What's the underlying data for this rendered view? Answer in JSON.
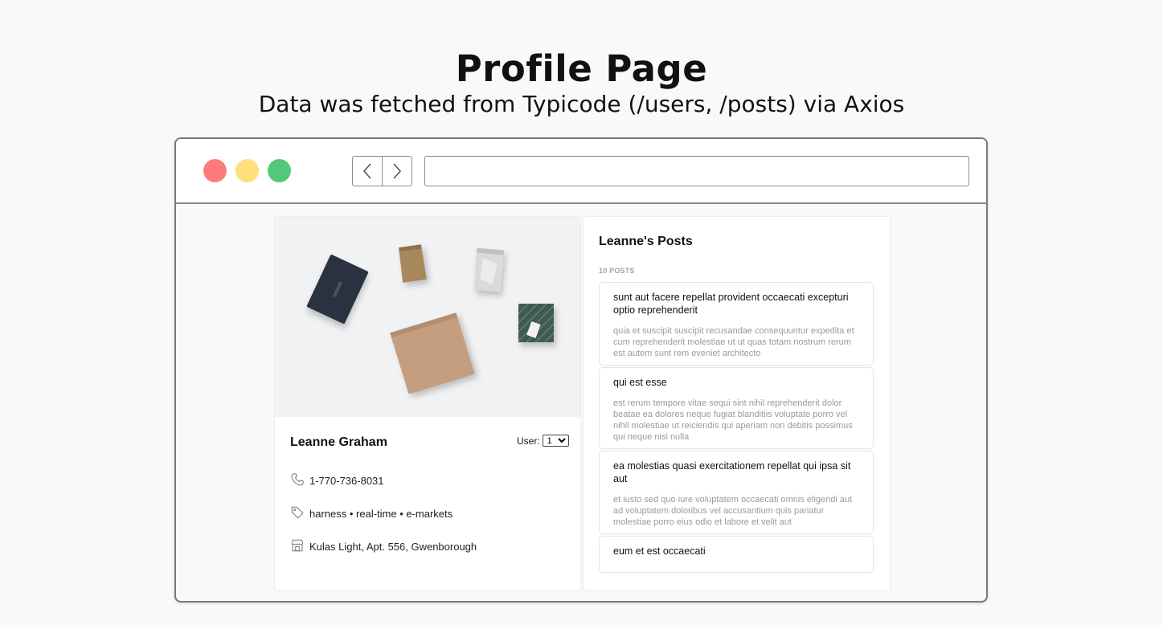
{
  "heading": {
    "title": "Profile Page",
    "subtitle": "Data was fetched from Typicode (/users, /posts) via Axios"
  },
  "browser": {
    "address_value": "",
    "window_controls": [
      "close",
      "minimize",
      "maximize"
    ],
    "nav_icons": [
      "chevron-left-icon",
      "chevron-right-icon"
    ]
  },
  "profile": {
    "name": "Leanne Graham",
    "user_label": "User:",
    "user_selected": "1",
    "phone": "1-770-736-8031",
    "tags": "harness • real-time • e-markets",
    "address": "Kulas Light, Apt. 556, Gwenborough",
    "icons": [
      "phone-icon",
      "tag-icon",
      "store-icon"
    ]
  },
  "posts": {
    "heading": "Leanne's Posts",
    "count_label": "10 POSTS",
    "items": [
      {
        "title": "sunt aut facere repellat provident occaecati excepturi optio reprehenderit",
        "body": "quia et suscipit suscipit recusandae consequuntur expedita et cum reprehenderit molestiae ut ut quas totam nostrum rerum est autem sunt rem eveniet architecto"
      },
      {
        "title": "qui est esse",
        "body": "est rerum tempore vitae sequi sint nihil reprehenderit dolor beatae ea dolores neque fugiat blanditiis voluptate porro vel nihil molestiae ut reiciendis qui aperiam non debitis possimus qui neque nisi nulla"
      },
      {
        "title": "ea molestias quasi exercitationem repellat qui ipsa sit aut",
        "body": "et iusto sed quo iure voluptatem occaecati omnis eligendi aut ad voluptatem doloribus vel accusantium quis pariatur molestiae porro eius odio et labore et velit aut"
      },
      {
        "title": "eum et est occaecati",
        "body": ""
      }
    ]
  },
  "colors": {
    "close": "#ff7b7b",
    "minimize": "#ffdf7b",
    "maximize": "#53c878"
  }
}
